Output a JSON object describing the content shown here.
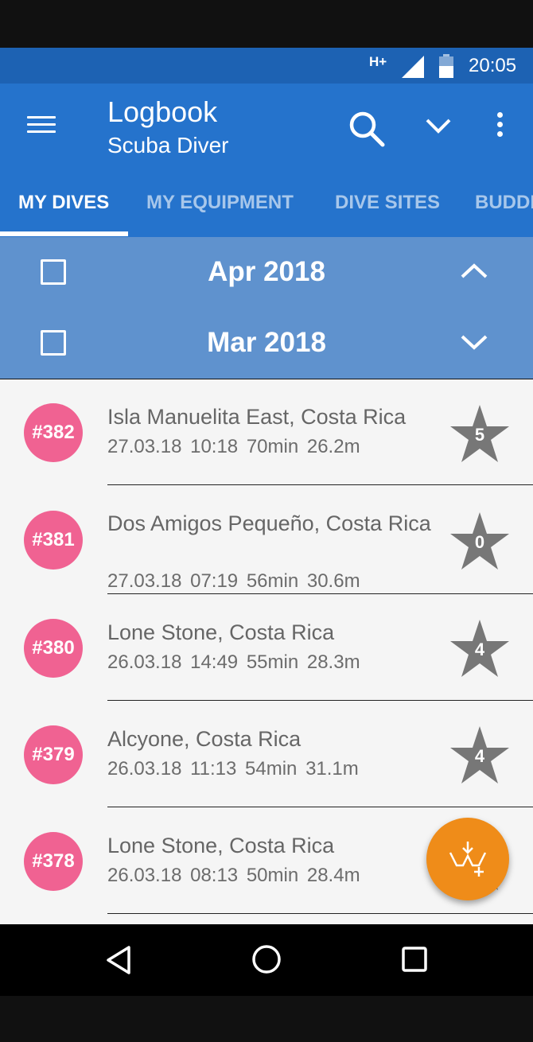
{
  "status_bar": {
    "network": "H+",
    "time": "20:05"
  },
  "app_bar": {
    "title": "Logbook",
    "subtitle": "Scuba Diver"
  },
  "tabs": [
    {
      "label": "MY DIVES",
      "active": true
    },
    {
      "label": "MY EQUIPMENT",
      "active": false
    },
    {
      "label": "DIVE SITES",
      "active": false
    },
    {
      "label": "BUDDI",
      "active": false
    }
  ],
  "months": [
    {
      "label": "Apr 2018",
      "expanded": false,
      "chevron": "chevron-up-icon"
    },
    {
      "label": "Mar 2018",
      "expanded": true,
      "chevron": "chevron-down-icon"
    }
  ],
  "dives": [
    {
      "number": "#382",
      "site": "Isla Manuelita East, Costa Rica",
      "meta": "27.03.18 10:18 70min 26.2m",
      "rating": "5"
    },
    {
      "number": "#381",
      "site": "Dos Amigos Pequeño, Costa Rica",
      "meta": "27.03.18 07:19 56min 30.6m",
      "rating": "0"
    },
    {
      "number": "#380",
      "site": "Lone Stone, Costa Rica",
      "meta": "26.03.18 14:49 55min 28.3m",
      "rating": "4"
    },
    {
      "number": "#379",
      "site": "Alcyone, Costa Rica",
      "meta": "26.03.18 11:13 54min 31.1m",
      "rating": "4"
    },
    {
      "number": "#378",
      "site": "Lone Stone, Costa Rica",
      "meta": "26.03.18 08:13 50min 28.4m",
      "rating": ""
    }
  ],
  "fab": {
    "icon": "add-dive-icon"
  },
  "colors": {
    "primary": "#2573cc",
    "status_bar": "#1d62b3",
    "month_header": "#5f92ce",
    "badge": "#f06292",
    "fab": "#ef8c19",
    "star": "#777777"
  }
}
